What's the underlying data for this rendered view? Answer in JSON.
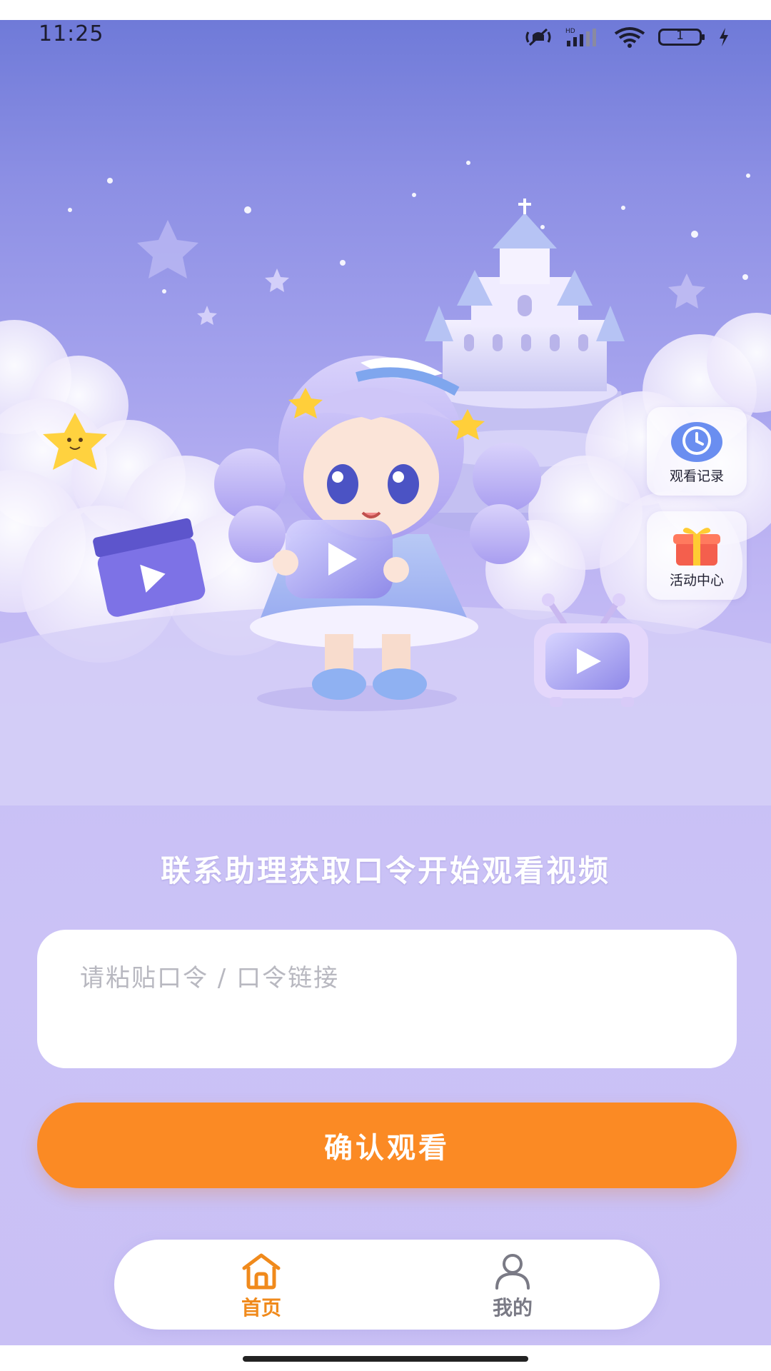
{
  "status_bar": {
    "time": "11:25",
    "battery_level": "1",
    "icons": [
      "mute-vibrate-icon",
      "hd-signal-icon",
      "wifi-icon",
      "battery-icon",
      "charging-bolt-icon"
    ]
  },
  "side_menu": {
    "history_label": "观看记录",
    "activity_label": "活动中心"
  },
  "main": {
    "prompt_title": "联系助理获取口令开始观看视频",
    "passcode_input": {
      "placeholder": "请粘贴口令 / 口令链接",
      "value": ""
    },
    "confirm_label": "确认观看"
  },
  "tab_bar": {
    "home_label": "首页",
    "mine_label": "我的",
    "active": "home"
  },
  "colors": {
    "accent_orange": "#fb8a24",
    "active_tab": "#f08a1c",
    "inactive_tab": "#7a7a85",
    "background_top": "#6f7ad8",
    "background_bottom": "#c9c0f5"
  }
}
